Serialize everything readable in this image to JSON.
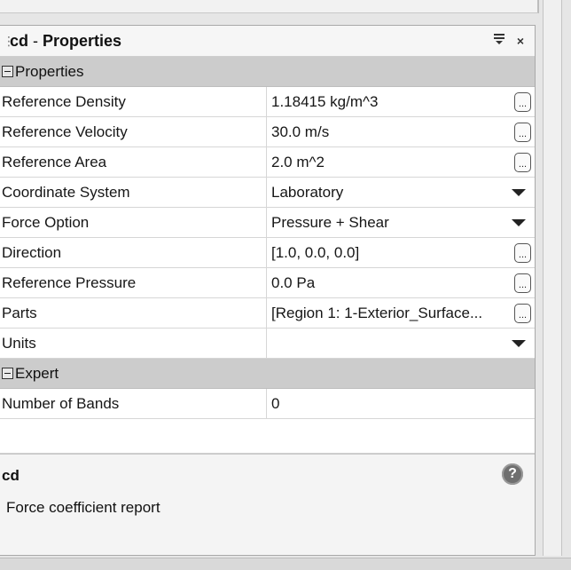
{
  "panel": {
    "title_name": "cd",
    "title_sep": "-",
    "title_label": "Properties",
    "menu_icon": "pin-menu-icon",
    "close_glyph": "×"
  },
  "sections": [
    {
      "label": "Properties",
      "rows": [
        {
          "name": "Reference Density",
          "value": "1.18415 kg/m^3",
          "control": "ellipsis"
        },
        {
          "name": "Reference Velocity",
          "value": "30.0 m/s",
          "control": "ellipsis"
        },
        {
          "name": "Reference Area",
          "value": "2.0 m^2",
          "control": "ellipsis"
        },
        {
          "name": "Coordinate System",
          "value": "Laboratory",
          "control": "dropdown"
        },
        {
          "name": "Force Option",
          "value": "Pressure + Shear",
          "control": "dropdown"
        },
        {
          "name": "Direction",
          "value": "[1.0, 0.0, 0.0]",
          "control": "ellipsis"
        },
        {
          "name": "Reference Pressure",
          "value": "0.0 Pa",
          "control": "ellipsis"
        },
        {
          "name": "Parts",
          "value": "[Region 1: 1-Exterior_Surface...",
          "control": "ellipsis"
        },
        {
          "name": "Units",
          "value": "",
          "control": "dropdown"
        }
      ]
    },
    {
      "label": "Expert",
      "rows": [
        {
          "name": "Number of Bands",
          "value": "0",
          "control": "none"
        }
      ]
    }
  ],
  "ellipsis_glyph": "...",
  "description": {
    "title": "cd",
    "text": "Force coefficient report",
    "help_glyph": "?"
  }
}
